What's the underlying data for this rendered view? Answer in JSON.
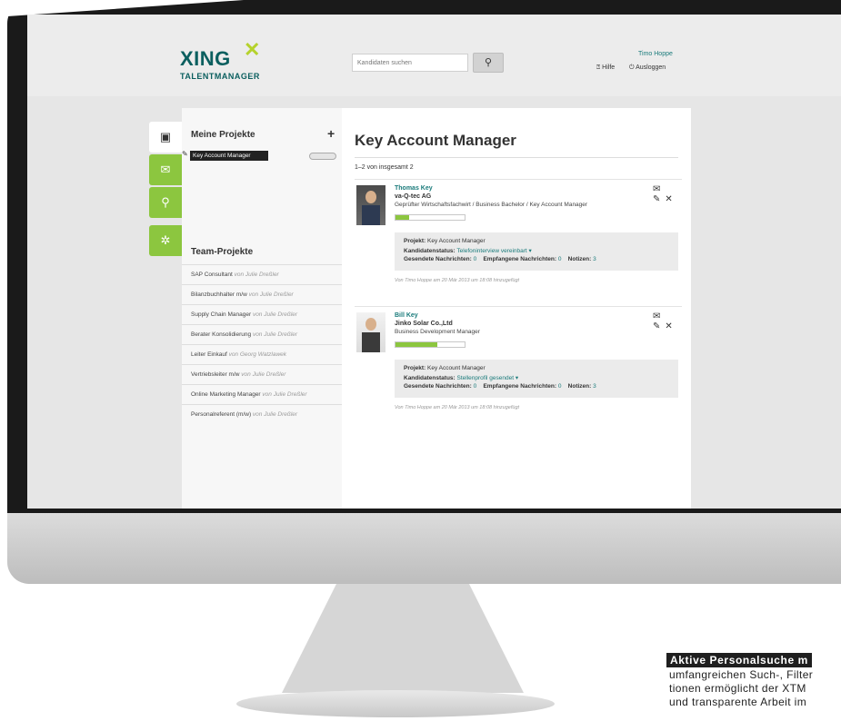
{
  "header": {
    "logo": "XING",
    "logo_sub": "TALENTMANAGER",
    "search_placeholder": "Kandidaten suchen",
    "search_icon": "magnifier-icon",
    "user_name": "Timo Hoppe",
    "help_label": "Hilfe",
    "logout_label": "Ausloggen"
  },
  "sidebar_tabs": [
    {
      "icon": "clipboard-icon",
      "active": true
    },
    {
      "icon": "envelope-icon",
      "active": false
    },
    {
      "icon": "search-icon",
      "active": false
    },
    {
      "icon": "gear-icon",
      "active": false
    }
  ],
  "projects": {
    "title": "Meine Projekte",
    "add_label": "+",
    "items": [
      {
        "label": "Key Account Manager"
      }
    ],
    "team_title": "Team-Projekte",
    "team_items": [
      {
        "name": "SAP Consultant",
        "by": "von Julie Dreßler"
      },
      {
        "name": "Bilanzbuchhalter m/w",
        "by": "von Julie Dreßler"
      },
      {
        "name": "Supply Chain Manager",
        "by": "von Julie Dreßler"
      },
      {
        "name": "Berater Konsolidierung",
        "by": "von Julie Dreßler"
      },
      {
        "name": "Leiter Einkauf",
        "by": "von Georg Watzlawek"
      },
      {
        "name": "Vertriebsleiter m/w",
        "by": "von Julie Dreßler"
      },
      {
        "name": "Online Marketing Manager",
        "by": "von Julie Dreßler"
      },
      {
        "name": "Personalreferent (m/w)",
        "by": "von Julie Dreßler"
      }
    ]
  },
  "main": {
    "title": "Key Account Manager",
    "count": "1–2 von insgesamt 2",
    "candidates": [
      {
        "name": "Thomas Key",
        "company": "va-Q-tec AG",
        "title": "Geprüfter Wirtschaftsfachwirt / Business Bachelor / Key Account Manager",
        "progress": 0.2,
        "project_label": "Projekt:",
        "project": "Key Account Manager",
        "status_label": "Kandidatenstatus:",
        "status": "Telefoninterview vereinbart ▾",
        "sent_label": "Gesendete Nachrichten:",
        "sent": "0",
        "received_label": "Empfangene Nachrichten:",
        "received": "0",
        "notes_label": "Notizen:",
        "notes": "3",
        "added": "Von Timo Hoppe am 20 Mär 2013 um 18:08 hinzugefügt"
      },
      {
        "name": "Bill Key",
        "company": "Jinko Solar Co.,Ltd",
        "title": "Business Development Manager",
        "progress": 0.6,
        "project_label": "Projekt:",
        "project": "Key Account Manager",
        "status_label": "Kandidatenstatus:",
        "status": "Stellenprofil gesendet ▾",
        "sent_label": "Gesendete Nachrichten:",
        "sent": "0",
        "received_label": "Empfangene Nachrichten:",
        "received": "0",
        "notes_label": "Notizen:",
        "notes": "3",
        "added": "Von Timo Hoppe am 20 Mär 2013 um 18:08 hinzugefügt"
      }
    ]
  },
  "caption": {
    "headline": "Aktive Personalsuche m",
    "line1": "umfangreichen Such-, Filter",
    "line2": "tionen ermöglicht der XTM",
    "line3": "und transparente Arbeit im"
  },
  "colors": {
    "accent": "#8cc63f",
    "brand": "#0b5f5f",
    "link": "#1a7b7b"
  }
}
